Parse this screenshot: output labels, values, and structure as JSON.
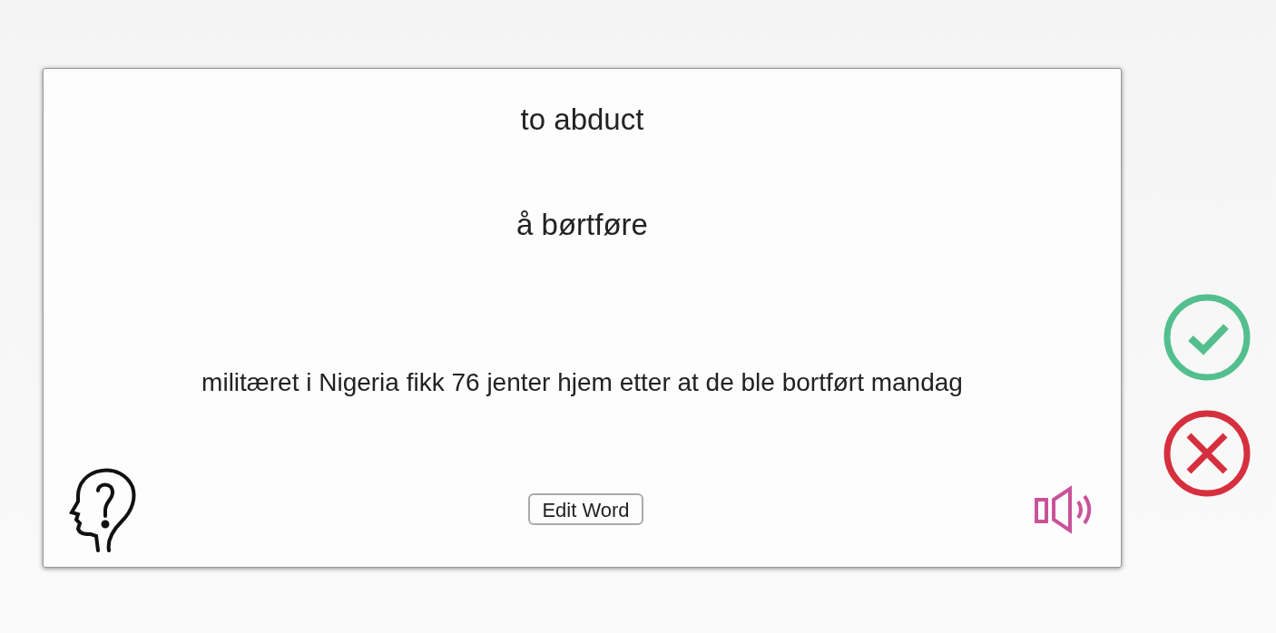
{
  "card": {
    "word": "to abduct",
    "translation": "å børtføre",
    "example": "militæret i Nigeria fikk 76 jenter hjem etter at de ble bortført mandag",
    "edit_button": "Edit Word"
  }
}
